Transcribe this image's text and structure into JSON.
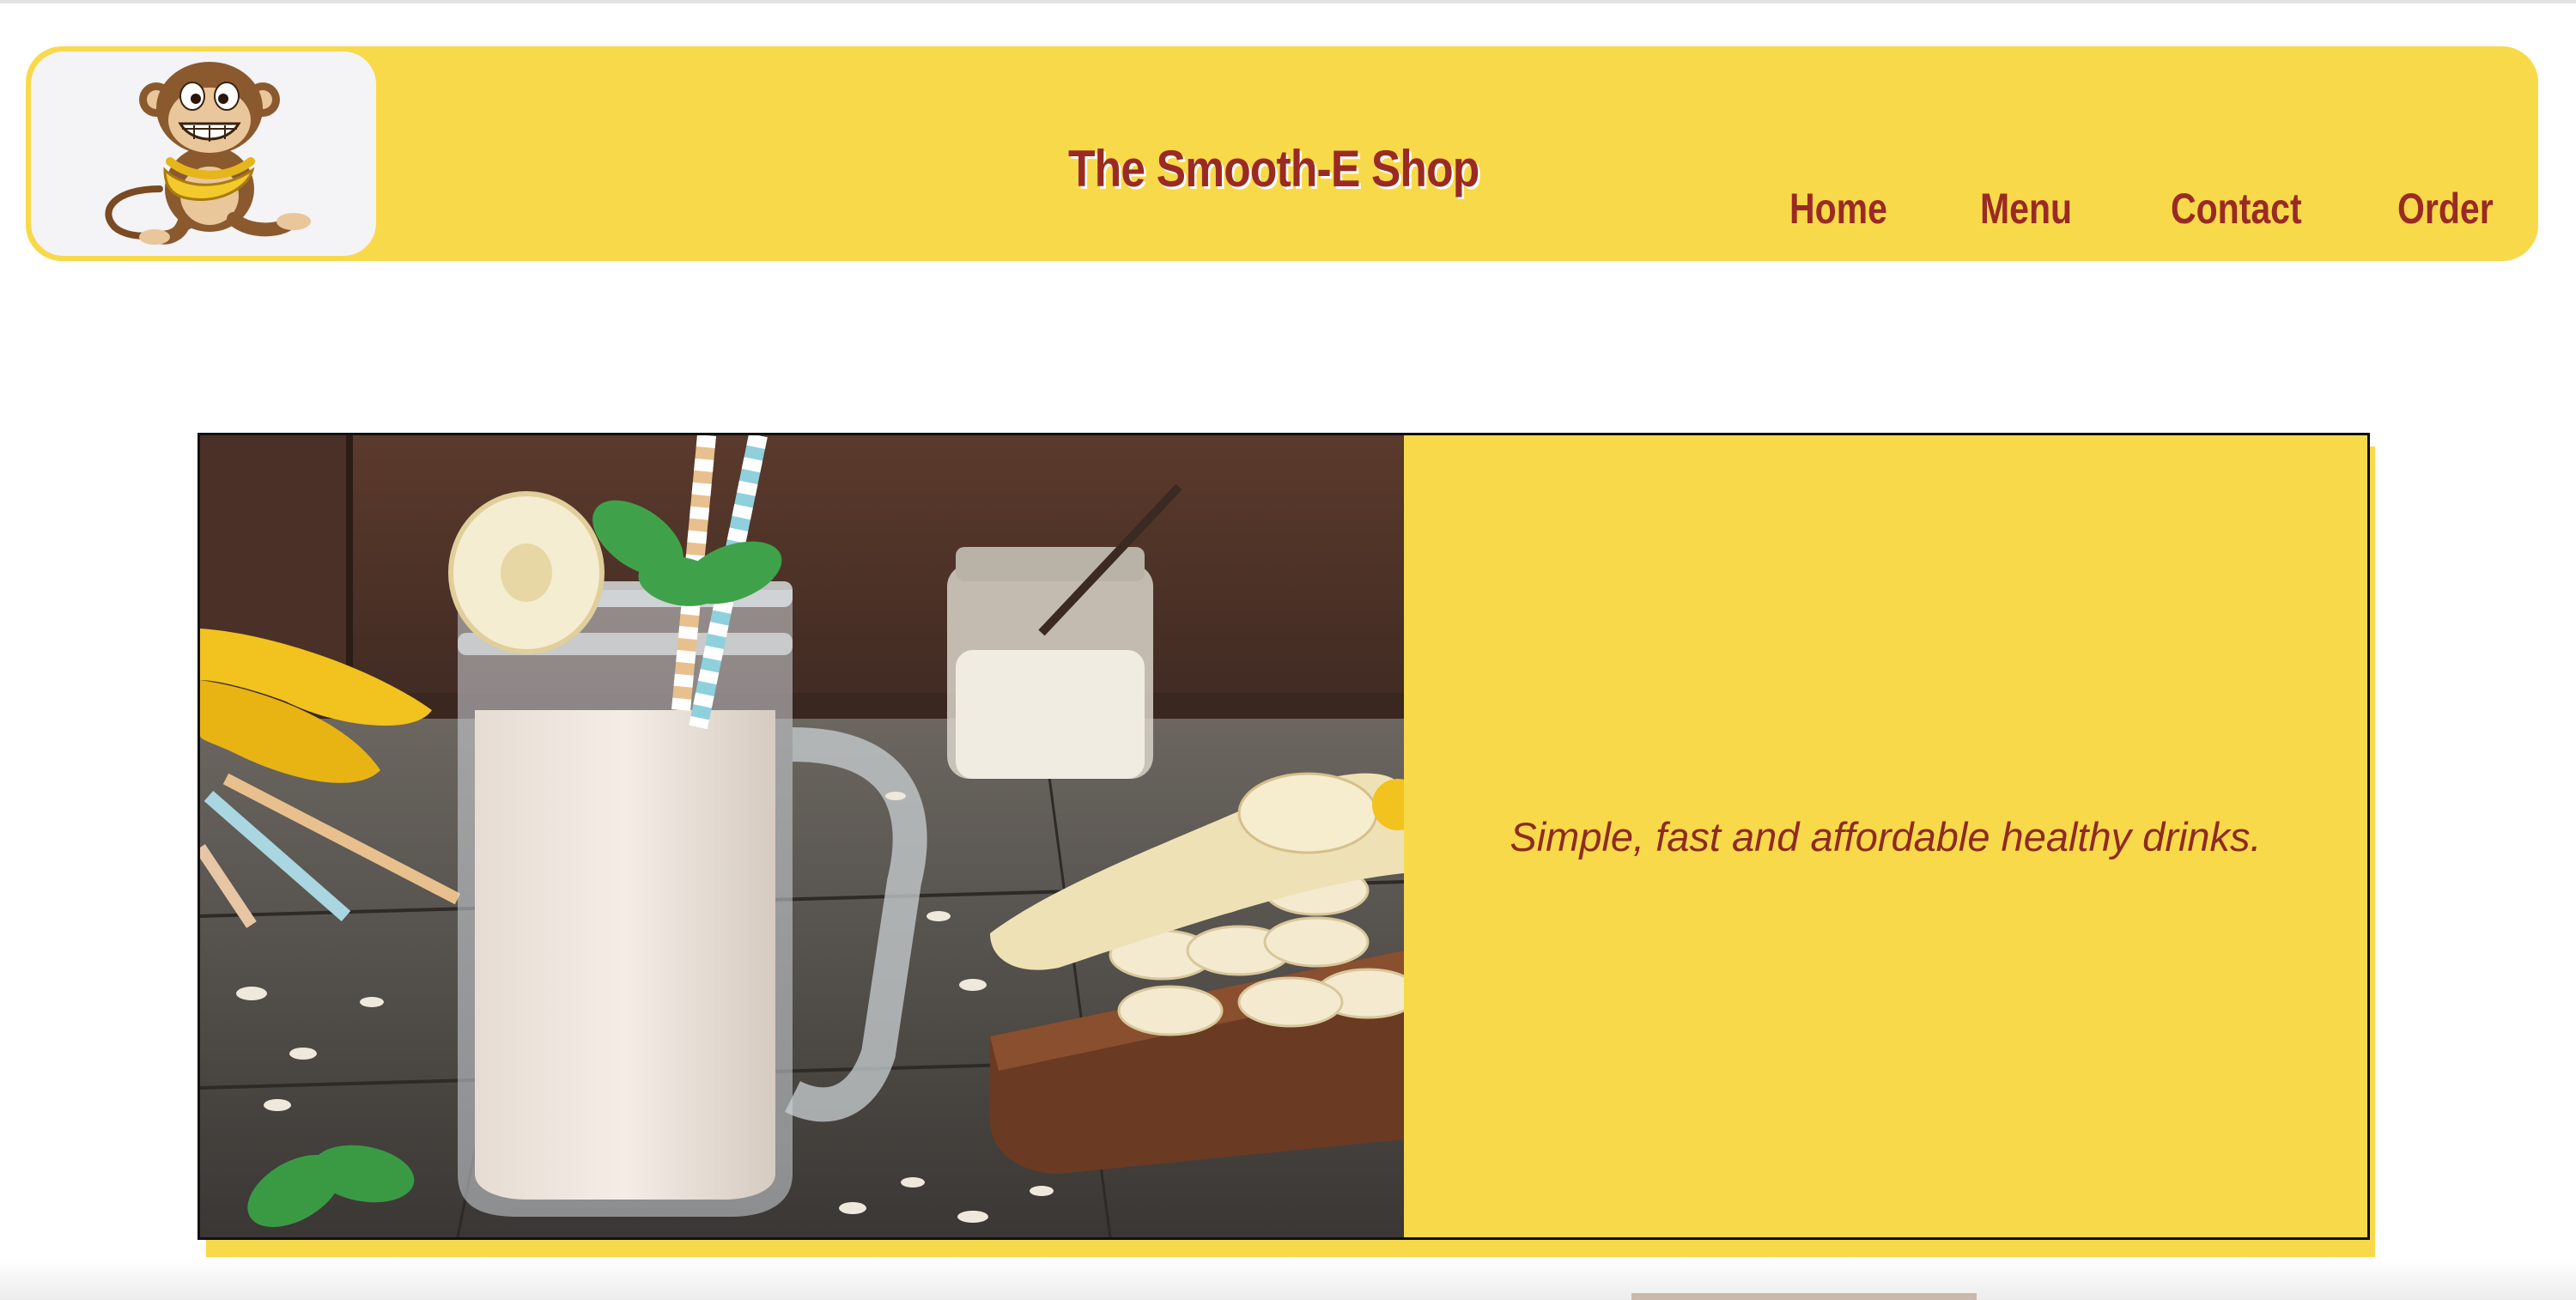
{
  "header": {
    "brand": "The Smooth-E Shop",
    "logo_icon": "monkey-holding-bananas-icon",
    "nav": [
      {
        "label": "Home"
      },
      {
        "label": "Menu"
      },
      {
        "label": "Contact"
      },
      {
        "label": "Order"
      }
    ]
  },
  "hero": {
    "image_description_icon": "banana-smoothie-jar-photo",
    "tagline": "Simple, fast and affordable healthy drinks."
  },
  "colors": {
    "brand_yellow": "#f8d94a",
    "brand_red": "#9a2a24",
    "logo_background": "#f4f3f5"
  }
}
